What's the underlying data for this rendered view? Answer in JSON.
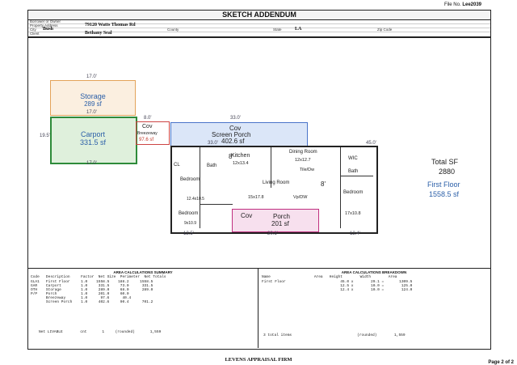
{
  "header": {
    "file_label": "File No.",
    "file_no": "Lee2039",
    "title": "SKETCH ADDENDUM"
  },
  "info": {
    "borrower_label": "Borrower or Owner",
    "address_label": "Property Address",
    "address": "79120 Watts Thomas Rd",
    "city_label": "City",
    "city": "Bush",
    "county_label": "County",
    "state_label": "State",
    "state": "LA",
    "zip_label": "Zip Code",
    "client_label": "Client",
    "client": "Bethany Seal"
  },
  "sketch": {
    "storage": {
      "name": "Storage",
      "area": "289 sf",
      "dim_w": "17.0'",
      "dim_h": "17.0'"
    },
    "carport": {
      "name": "Carport",
      "area": "331.5 sf",
      "dim_w": "17.0'",
      "dim_h": "19.5'"
    },
    "breezeway": {
      "name": "Cov",
      "sub": "Breezeway",
      "area": "97.6 sf",
      "dim": "8.0'"
    },
    "screen_porch": {
      "name": "Cov",
      "sub": "Screen Porch",
      "area": "402.6 sf",
      "dim": "33.0'"
    },
    "porch": {
      "name": "Cov",
      "sub": "Porch",
      "area": "201 sf",
      "dim": "20.1'"
    },
    "rooms": [
      "Kitchen",
      "12x13.4",
      "Dining Room",
      "12x12.7",
      "Tile/Dw",
      "Living Room",
      "15x17.8",
      "Vp/DW",
      "Bedroom",
      "12.4x10.5",
      "Bath",
      "Bedroom",
      "17x10.8",
      "Bedroom",
      "9x10.9",
      "CL",
      "Bath",
      "WIC"
    ],
    "dims": [
      "33.0'",
      "45.0'",
      "12.5'",
      "12.4'",
      "20.1'",
      "8'",
      "8'"
    ],
    "total_label": "Total SF",
    "total": "2880",
    "floor_label": "First Floor",
    "floor_area": "1558.5 sf"
  },
  "summary": {
    "title": "AREA CALCULATIONS SUMMARY",
    "headers": [
      "Code",
      "Description",
      "Factor",
      "Net Size",
      "Perimeter",
      "Net Totals"
    ],
    "rows": [
      [
        "GLA1",
        "First Floor",
        "1.0",
        "1558.5",
        "188.2",
        "1558.5"
      ],
      [
        "GAR",
        "Carport",
        "1.0",
        "331.5",
        "73.0",
        "331.5"
      ],
      [
        "OTH",
        "Storage",
        "1.0",
        "289.0",
        "68.0",
        "289.0"
      ],
      [
        "P/P",
        "Porch",
        "1.0",
        "201.0",
        "60.0",
        ""
      ],
      [
        "",
        "Breezeway",
        "1.0",
        "97.6",
        "40.4",
        ""
      ],
      [
        "",
        "Screen Porch",
        "1.0",
        "402.6",
        "90.4",
        "701.2"
      ]
    ],
    "net_label": "Net LIVABLE",
    "net_unit": "cnt",
    "net_count": "1",
    "net_rounded": "(rounded)",
    "net_total": "1,559"
  },
  "breakdown": {
    "title": "AREA CALCULATIONS BREAKDOWN",
    "headers": [
      "Name",
      "Area",
      "Height",
      "Width",
      "Area"
    ],
    "rows": [
      [
        "First Floor",
        "",
        "45.0 x",
        "29.1 =",
        "1309.5"
      ],
      [
        "",
        "",
        "12.5 x",
        "10.0 =",
        "125.0"
      ],
      [
        "",
        "",
        "12.4 x",
        "10.0 =",
        "124.0"
      ]
    ],
    "total_label": "3 total items",
    "rounded": "(rounded)",
    "total": "1,559"
  },
  "footer": {
    "firm": "LEVENS APPRAISAL FIRM",
    "page": "Page 2 of 2"
  }
}
